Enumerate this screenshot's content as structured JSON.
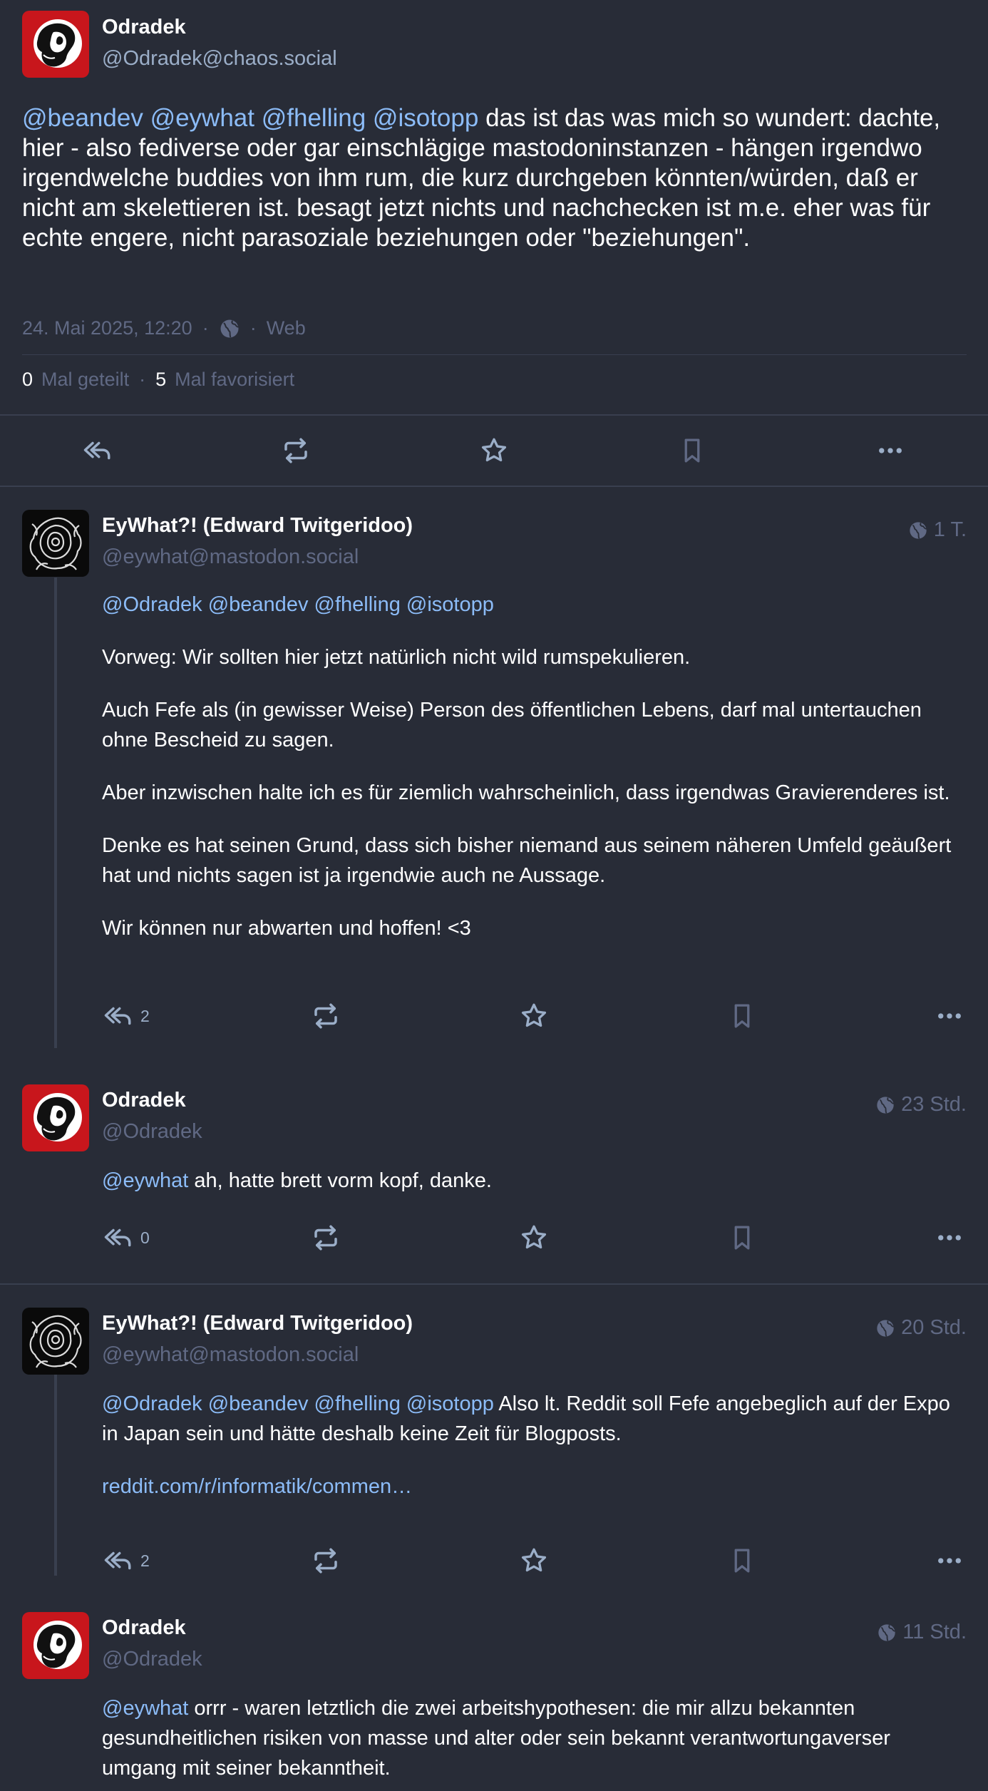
{
  "focus": {
    "display_name": "Odradek",
    "acct": "@Odradek@chaos.social",
    "mentions": [
      "@beandev",
      "@eywhat",
      "@fhelling",
      "@isotopp"
    ],
    "text": "das ist das was mich so wundert: dachte, hier - also fediverse oder gar einschlägige mastodoninstanzen - hängen irgendwo irgendwelche buddies von ihm rum, die kurz durchgeben könnten/würden, daß er nicht am skelettieren ist. besagt jetzt nichts und nachchecken ist m.e. eher was für echte engere, nicht parasoziale beziehungen oder \"beziehungen\".",
    "date": "24. Mai 2025, 12:20",
    "sep": "·",
    "app": "Web",
    "boosts": "0",
    "boosts_label": "Mal geteilt",
    "favs": "5",
    "favs_label": "Mal favorisiert"
  },
  "replies": [
    {
      "display_name": "EyWhat?! (Edward Twitgeridoo)",
      "acct": "@eywhat@mastodon.social",
      "time": "1 T.",
      "mentions": [
        "@Odradek",
        "@beandev",
        "@fhelling",
        "@isotopp"
      ],
      "paragraphs": [
        "Vorweg: Wir sollten hier jetzt natürlich nicht wild rumspekulieren.",
        "Auch Fefe als (in gewisser Weise) Person des öffentlichen Lebens, darf mal untertauchen ohne Bescheid zu sagen.",
        "Aber inzwischen halte ich es für ziemlich wahrscheinlich, dass irgendwas Gravierenderes ist.",
        "Denke es hat seinen Grund, dass sich bisher niemand aus seinem näheren Umfeld geäußert hat und nichts sagen ist ja irgendwie auch ne Aussage.",
        "Wir können nur abwarten und hoffen! <3"
      ],
      "reply_count": "2"
    },
    {
      "display_name": "Odradek",
      "acct": "@Odradek",
      "time": "23 Std.",
      "mentions": [
        "@eywhat"
      ],
      "text": "ah, hatte brett vorm kopf, danke.",
      "reply_count": "0"
    },
    {
      "display_name": "EyWhat?! (Edward Twitgeridoo)",
      "acct": "@eywhat@mastodon.social",
      "time": "20 Std.",
      "mentions": [
        "@Odradek",
        "@beandev",
        "@fhelling",
        "@isotopp"
      ],
      "text": "Also lt. Reddit soll Fefe angebeglich auf der Expo in Japan sein und hätte deshalb keine Zeit für Blogposts.",
      "link": "reddit.com/r/informatik/commen…",
      "reply_count": "2"
    },
    {
      "display_name": "Odradek",
      "acct": "@Odradek",
      "time": "11 Std.",
      "mentions": [
        "@eywhat"
      ],
      "text": "orrr - waren letztlich die zwei arbeitshypothesen: die mir allzu bekannten gesundheitlichen risiken von masse und alter oder sein bekannt verantwortungaverser umgang mit seiner bekanntheit."
    }
  ],
  "icons": {
    "reply": "reply-all-icon",
    "boost": "boost-icon",
    "favourite": "star-icon",
    "bookmark": "bookmark-icon",
    "more": "more-icon",
    "visibility": "globe-icon"
  },
  "colors": {
    "background": "#282c37",
    "mention": "#8cbcf8",
    "secondary": "#9baec8",
    "muted": "#606984"
  }
}
